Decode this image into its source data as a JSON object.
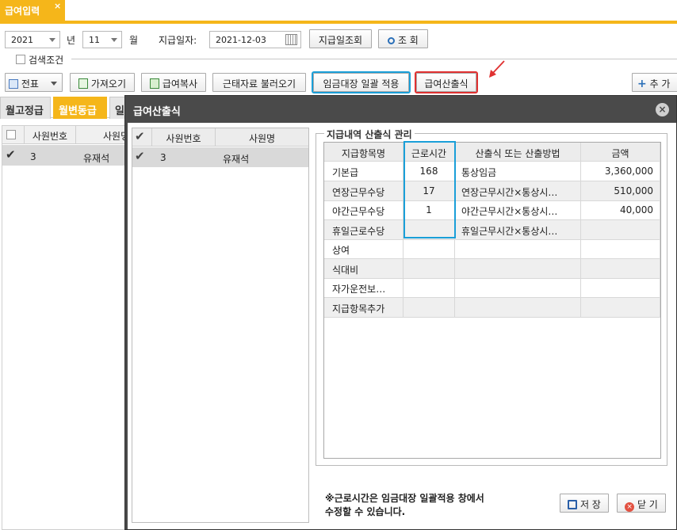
{
  "tab": {
    "label": "급여입력",
    "close": "×"
  },
  "filter": {
    "year": "2021",
    "year_unit": "년",
    "month": "11",
    "month_unit": "월",
    "pay_date_label": "지급일자:",
    "pay_date": "2021-12-03",
    "pay_date_lookup": "지급일조회",
    "search": "조 회"
  },
  "search_condition": "검색조건",
  "toolbar": {
    "voucher": "전표",
    "import": "가져오기",
    "copy": "급여복사",
    "attendance": "근태자료 불러오기",
    "ledger_apply": "임금대장 일괄 적용",
    "calc": "급여산출식",
    "add": "추 가"
  },
  "section_tabs": [
    "월고정급",
    "월변동급",
    "일"
  ],
  "bg_grid": {
    "headers": [
      "사원번호",
      "사원명"
    ],
    "rows": [
      {
        "id": "3",
        "name": "유재석"
      }
    ]
  },
  "dialog": {
    "title": "급여산출식",
    "close": "×",
    "emp_headers": [
      "사원번호",
      "사원명"
    ],
    "emp_rows": [
      {
        "id": "3",
        "name": "유재석"
      }
    ],
    "group_title": "지급내역 산출식 관리",
    "table_headers": [
      "지급항목명",
      "근로시간",
      "산출식 또는 산출방법",
      "금액"
    ],
    "table_rows": [
      {
        "item": "기본급",
        "hours": "168",
        "formula": "통상임금",
        "amount": "3,360,000"
      },
      {
        "item": "연장근무수당",
        "hours": "17",
        "formula": "연장근무시간×통상시…",
        "amount": "510,000"
      },
      {
        "item": "야간근무수당",
        "hours": "1",
        "formula": "야간근무시간×통상시…",
        "amount": "40,000"
      },
      {
        "item": "휴일근로수당",
        "hours": "",
        "formula": "휴일근무시간×통상시…",
        "amount": ""
      },
      {
        "item": "상여",
        "hours": "",
        "formula": "",
        "amount": ""
      },
      {
        "item": "식대비",
        "hours": "",
        "formula": "",
        "amount": ""
      },
      {
        "item": "자가운전보…",
        "hours": "",
        "formula": "",
        "amount": ""
      },
      {
        "item": "지급항목추가",
        "hours": "",
        "formula": "",
        "amount": ""
      }
    ],
    "note_line1": "※근로시간은 임금대장 일괄적용 창에서",
    "note_line2": "수정할 수 있습니다.",
    "save": "저 장",
    "close_btn": "닫 기"
  },
  "colors": {
    "accent": "#f5b61a",
    "highlight_blue": "#1a9fd8",
    "highlight_red": "#e03131"
  }
}
